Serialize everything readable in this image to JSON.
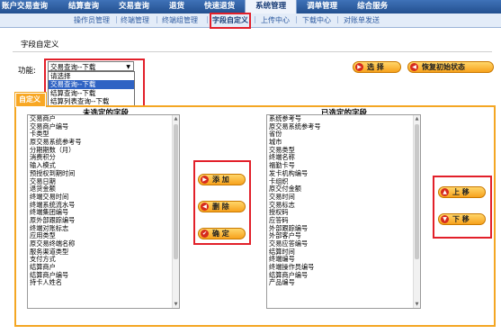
{
  "topnav": {
    "items": [
      "账户交易查询",
      "结算查询",
      "交易查询",
      "退货",
      "快速退货",
      "系统管理",
      "调单管理",
      "综合服务"
    ],
    "active_index": 5
  },
  "subnav": {
    "items": [
      "操作员管理",
      "终端管理",
      "终端组管理",
      "字段自定义",
      "上传中心",
      "下载中心",
      "对账单发送"
    ],
    "separator": "|",
    "active_index": 3
  },
  "page_title": "字段自定义",
  "function": {
    "label": "功能:",
    "selected": "交易查询--下载",
    "options": [
      "请选择",
      "交易查询--下载",
      "结算查询--下载",
      "结算列表查询--下载"
    ],
    "highlighted_index": 1
  },
  "buttons": {
    "select": "选 择",
    "restore": "恢复初始状态",
    "add": "添 加",
    "delete": "删 除",
    "confirm": "确 定",
    "move_up": "上 移",
    "move_down": "下 移"
  },
  "tab_label": "自定义",
  "available": {
    "header": "未选定的字段",
    "fields": [
      "交易商户",
      "交易商户编号",
      "卡类型",
      "原交易系统参考号",
      "分期期数（月）",
      "消费积分",
      "输入模式",
      "预授权到期时间",
      "交易日期",
      "退货金额",
      "终端交易时间",
      "终端系统流水号",
      "终端集团编号",
      "原外部跟踪编号",
      "终端对账标志",
      "应用类型",
      "原交易终端名称",
      "服务渠道类型",
      "支付方式",
      "结算商户",
      "结算商户编号",
      "持卡人姓名"
    ]
  },
  "selected": {
    "header": "已选定的字段",
    "fields": [
      "系统参考号",
      "原交易系统参考号",
      "省份",
      "城市",
      "交易类型",
      "终端名称",
      "福勤卡号",
      "发卡机构编号",
      "卡组织",
      "原交付金额",
      "交易时间",
      "交易标志",
      "授权码",
      "应答码",
      "外部跟踪编号",
      "外部客户号",
      "交易应答编号",
      "结算时间",
      "终端编号",
      "终端操作员编号",
      "结算商户编号",
      "产品编号"
    ]
  },
  "colors": {
    "nav_blue": "#23508f",
    "orange": "#f4a623",
    "highlight_red": "#e2202a",
    "selection_blue": "#2f63c4"
  },
  "icons": {
    "select": "arrow-right-icon",
    "restore": "arrow-left-icon",
    "add": "arrow-right-icon",
    "delete": "arrow-left-icon",
    "confirm": "check-icon",
    "move_up": "arrow-up-icon",
    "move_down": "arrow-down-icon"
  }
}
